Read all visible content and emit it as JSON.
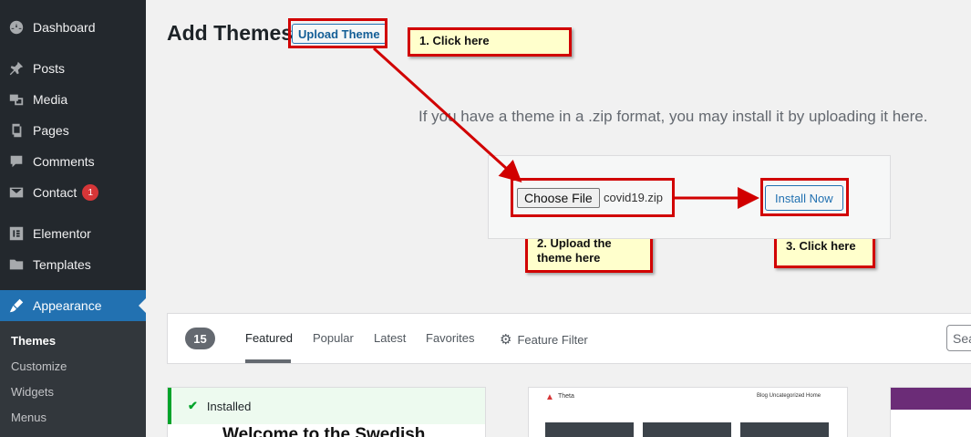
{
  "sidebar": {
    "items": [
      {
        "label": "Dashboard",
        "icon": "dashboard-icon"
      },
      {
        "label": "Posts",
        "icon": "pin-icon"
      },
      {
        "label": "Media",
        "icon": "media-icon"
      },
      {
        "label": "Pages",
        "icon": "pages-icon"
      },
      {
        "label": "Comments",
        "icon": "comment-icon"
      },
      {
        "label": "Contact",
        "icon": "mail-icon",
        "badge": "1"
      },
      {
        "label": "Elementor",
        "icon": "elementor-icon"
      },
      {
        "label": "Templates",
        "icon": "folder-icon"
      },
      {
        "label": "Appearance",
        "icon": "brush-icon"
      }
    ],
    "submenu": [
      "Themes",
      "Customize",
      "Widgets",
      "Menus"
    ]
  },
  "header": {
    "title": "Add Themes",
    "upload_button": "Upload Theme"
  },
  "annotations": {
    "step1": "1. Click here",
    "step2": "2. Upload the theme here",
    "step3": "3. Click here"
  },
  "upload": {
    "description": "If you have a theme in a .zip format, you may install it by uploading it here.",
    "choose_file": "Choose File",
    "file_name": "covid19.zip",
    "install_button": "Install Now"
  },
  "filter": {
    "count": "15",
    "tabs": [
      "Featured",
      "Popular",
      "Latest",
      "Favorites"
    ],
    "feature_filter": "Feature Filter",
    "search_placeholder": "Sea"
  },
  "cards": {
    "installed_label": "Installed",
    "card1_title": "Welcome to the Swedish",
    "card2_logo": "Theta",
    "card2_nav": "Blog  Uncategorized  Home"
  },
  "colors": {
    "sidebar_bg": "#23282d",
    "accent": "#2271b1",
    "annotation_red": "#d10000",
    "note_bg": "#ffffcc"
  }
}
